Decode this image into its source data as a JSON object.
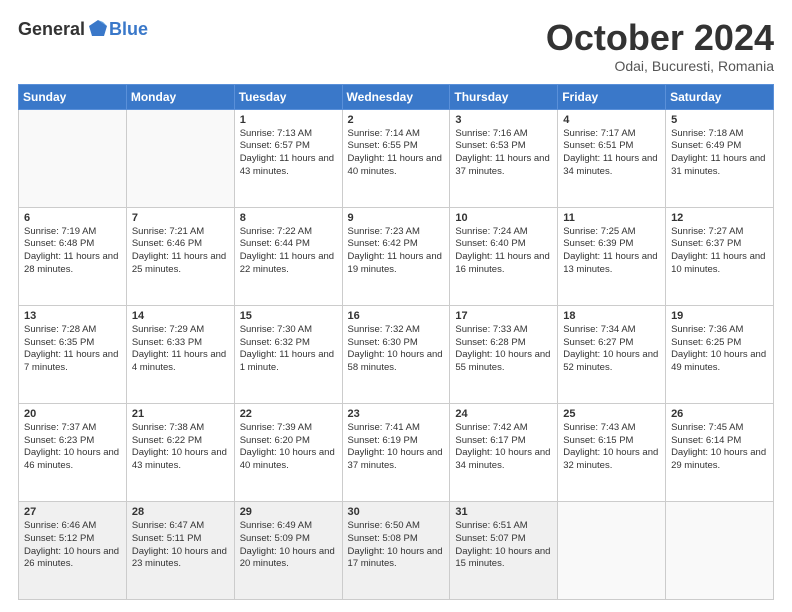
{
  "header": {
    "logo_general": "General",
    "logo_blue": "Blue",
    "month_title": "October 2024",
    "location": "Odai, Bucuresti, Romania"
  },
  "weekdays": [
    "Sunday",
    "Monday",
    "Tuesday",
    "Wednesday",
    "Thursday",
    "Friday",
    "Saturday"
  ],
  "weeks": [
    [
      {
        "day": "",
        "empty": true
      },
      {
        "day": "",
        "empty": true
      },
      {
        "day": "1",
        "sunrise": "Sunrise: 7:13 AM",
        "sunset": "Sunset: 6:57 PM",
        "daylight": "Daylight: 11 hours and 43 minutes."
      },
      {
        "day": "2",
        "sunrise": "Sunrise: 7:14 AM",
        "sunset": "Sunset: 6:55 PM",
        "daylight": "Daylight: 11 hours and 40 minutes."
      },
      {
        "day": "3",
        "sunrise": "Sunrise: 7:16 AM",
        "sunset": "Sunset: 6:53 PM",
        "daylight": "Daylight: 11 hours and 37 minutes."
      },
      {
        "day": "4",
        "sunrise": "Sunrise: 7:17 AM",
        "sunset": "Sunset: 6:51 PM",
        "daylight": "Daylight: 11 hours and 34 minutes."
      },
      {
        "day": "5",
        "sunrise": "Sunrise: 7:18 AM",
        "sunset": "Sunset: 6:49 PM",
        "daylight": "Daylight: 11 hours and 31 minutes."
      }
    ],
    [
      {
        "day": "6",
        "sunrise": "Sunrise: 7:19 AM",
        "sunset": "Sunset: 6:48 PM",
        "daylight": "Daylight: 11 hours and 28 minutes."
      },
      {
        "day": "7",
        "sunrise": "Sunrise: 7:21 AM",
        "sunset": "Sunset: 6:46 PM",
        "daylight": "Daylight: 11 hours and 25 minutes."
      },
      {
        "day": "8",
        "sunrise": "Sunrise: 7:22 AM",
        "sunset": "Sunset: 6:44 PM",
        "daylight": "Daylight: 11 hours and 22 minutes."
      },
      {
        "day": "9",
        "sunrise": "Sunrise: 7:23 AM",
        "sunset": "Sunset: 6:42 PM",
        "daylight": "Daylight: 11 hours and 19 minutes."
      },
      {
        "day": "10",
        "sunrise": "Sunrise: 7:24 AM",
        "sunset": "Sunset: 6:40 PM",
        "daylight": "Daylight: 11 hours and 16 minutes."
      },
      {
        "day": "11",
        "sunrise": "Sunrise: 7:25 AM",
        "sunset": "Sunset: 6:39 PM",
        "daylight": "Daylight: 11 hours and 13 minutes."
      },
      {
        "day": "12",
        "sunrise": "Sunrise: 7:27 AM",
        "sunset": "Sunset: 6:37 PM",
        "daylight": "Daylight: 11 hours and 10 minutes."
      }
    ],
    [
      {
        "day": "13",
        "sunrise": "Sunrise: 7:28 AM",
        "sunset": "Sunset: 6:35 PM",
        "daylight": "Daylight: 11 hours and 7 minutes."
      },
      {
        "day": "14",
        "sunrise": "Sunrise: 7:29 AM",
        "sunset": "Sunset: 6:33 PM",
        "daylight": "Daylight: 11 hours and 4 minutes."
      },
      {
        "day": "15",
        "sunrise": "Sunrise: 7:30 AM",
        "sunset": "Sunset: 6:32 PM",
        "daylight": "Daylight: 11 hours and 1 minute."
      },
      {
        "day": "16",
        "sunrise": "Sunrise: 7:32 AM",
        "sunset": "Sunset: 6:30 PM",
        "daylight": "Daylight: 10 hours and 58 minutes."
      },
      {
        "day": "17",
        "sunrise": "Sunrise: 7:33 AM",
        "sunset": "Sunset: 6:28 PM",
        "daylight": "Daylight: 10 hours and 55 minutes."
      },
      {
        "day": "18",
        "sunrise": "Sunrise: 7:34 AM",
        "sunset": "Sunset: 6:27 PM",
        "daylight": "Daylight: 10 hours and 52 minutes."
      },
      {
        "day": "19",
        "sunrise": "Sunrise: 7:36 AM",
        "sunset": "Sunset: 6:25 PM",
        "daylight": "Daylight: 10 hours and 49 minutes."
      }
    ],
    [
      {
        "day": "20",
        "sunrise": "Sunrise: 7:37 AM",
        "sunset": "Sunset: 6:23 PM",
        "daylight": "Daylight: 10 hours and 46 minutes."
      },
      {
        "day": "21",
        "sunrise": "Sunrise: 7:38 AM",
        "sunset": "Sunset: 6:22 PM",
        "daylight": "Daylight: 10 hours and 43 minutes."
      },
      {
        "day": "22",
        "sunrise": "Sunrise: 7:39 AM",
        "sunset": "Sunset: 6:20 PM",
        "daylight": "Daylight: 10 hours and 40 minutes."
      },
      {
        "day": "23",
        "sunrise": "Sunrise: 7:41 AM",
        "sunset": "Sunset: 6:19 PM",
        "daylight": "Daylight: 10 hours and 37 minutes."
      },
      {
        "day": "24",
        "sunrise": "Sunrise: 7:42 AM",
        "sunset": "Sunset: 6:17 PM",
        "daylight": "Daylight: 10 hours and 34 minutes."
      },
      {
        "day": "25",
        "sunrise": "Sunrise: 7:43 AM",
        "sunset": "Sunset: 6:15 PM",
        "daylight": "Daylight: 10 hours and 32 minutes."
      },
      {
        "day": "26",
        "sunrise": "Sunrise: 7:45 AM",
        "sunset": "Sunset: 6:14 PM",
        "daylight": "Daylight: 10 hours and 29 minutes."
      }
    ],
    [
      {
        "day": "27",
        "sunrise": "Sunrise: 6:46 AM",
        "sunset": "Sunset: 5:12 PM",
        "daylight": "Daylight: 10 hours and 26 minutes."
      },
      {
        "day": "28",
        "sunrise": "Sunrise: 6:47 AM",
        "sunset": "Sunset: 5:11 PM",
        "daylight": "Daylight: 10 hours and 23 minutes."
      },
      {
        "day": "29",
        "sunrise": "Sunrise: 6:49 AM",
        "sunset": "Sunset: 5:09 PM",
        "daylight": "Daylight: 10 hours and 20 minutes."
      },
      {
        "day": "30",
        "sunrise": "Sunrise: 6:50 AM",
        "sunset": "Sunset: 5:08 PM",
        "daylight": "Daylight: 10 hours and 17 minutes."
      },
      {
        "day": "31",
        "sunrise": "Sunrise: 6:51 AM",
        "sunset": "Sunset: 5:07 PM",
        "daylight": "Daylight: 10 hours and 15 minutes."
      },
      {
        "day": "",
        "empty": true
      },
      {
        "day": "",
        "empty": true
      }
    ]
  ]
}
